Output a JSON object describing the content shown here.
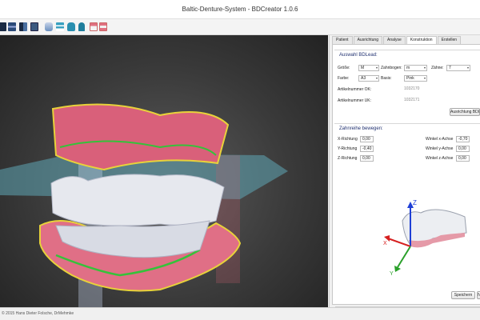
{
  "window": {
    "title": "Baltic-Denture-System - BDCreator 1.0.6"
  },
  "toolbar": {
    "icons": [
      "view-front-icon",
      "view-bar-icon",
      "view-split-icon",
      "view-grid-icon",
      "model-toggle-icon",
      "lines-icon",
      "tooth-upper-icon",
      "tooth-single-icon",
      "teeth-row-icon",
      "layers-icon",
      "layers-alt-icon"
    ]
  },
  "tabs": [
    "Patient",
    "Ausrichtung",
    "Analyse",
    "Konstruktion",
    "Erstellen"
  ],
  "active_tab": "Konstruktion",
  "auswahl": {
    "title": "Auswahl BDLead:",
    "groesse_label": "Größe:",
    "groesse_value": "M",
    "zahnbogen_label": "Zahnbogen:",
    "zahnbogen_value": "m",
    "zaehne_label": "Zähne:",
    "zaehne_value": "7",
    "farbe_label": "Farbe:",
    "farbe_value": "A3",
    "basis_label": "Basis:",
    "basis_value": "Pink",
    "artikel_ok_label": "Artikelnummer OK:",
    "artikel_ok_value": "1032170",
    "artikel_uk_label": "Artikelnummer UK:",
    "artikel_uk_value": "1032171",
    "ausrichtung_button": "Ausrichtung BDLead"
  },
  "zahnreihe": {
    "title": "Zahnreihe bewegen:",
    "x_label": "X-Richtung",
    "x_value": "0,00",
    "y_label": "Y-Richtung",
    "y_value": "-0,40",
    "z_label": "Z-Richtung",
    "z_value": "0,00",
    "wx_label": "Winkel x-Achse",
    "wx_value": "-0,70",
    "wy_label": "Winkel y-Achse",
    "wy_value": "0,00",
    "wz_label": "Winkel z-Achse",
    "wz_value": "0,00"
  },
  "axes": {
    "z": "Z",
    "y": "Y",
    "x": "X"
  },
  "buttons": {
    "speichern": "Speichern",
    "next": "N"
  },
  "status": {
    "text": "© 2015 Hans Dieter Folsche, DrMehmke"
  },
  "colors": {
    "gum": "#d9607a",
    "outline": "#e8d23a",
    "gingiva_line": "#35c23a",
    "plane": "#5fa5b5",
    "axis_z": "#1e3fd6",
    "axis_x": "#d62020",
    "axis_y": "#2aa02a"
  }
}
